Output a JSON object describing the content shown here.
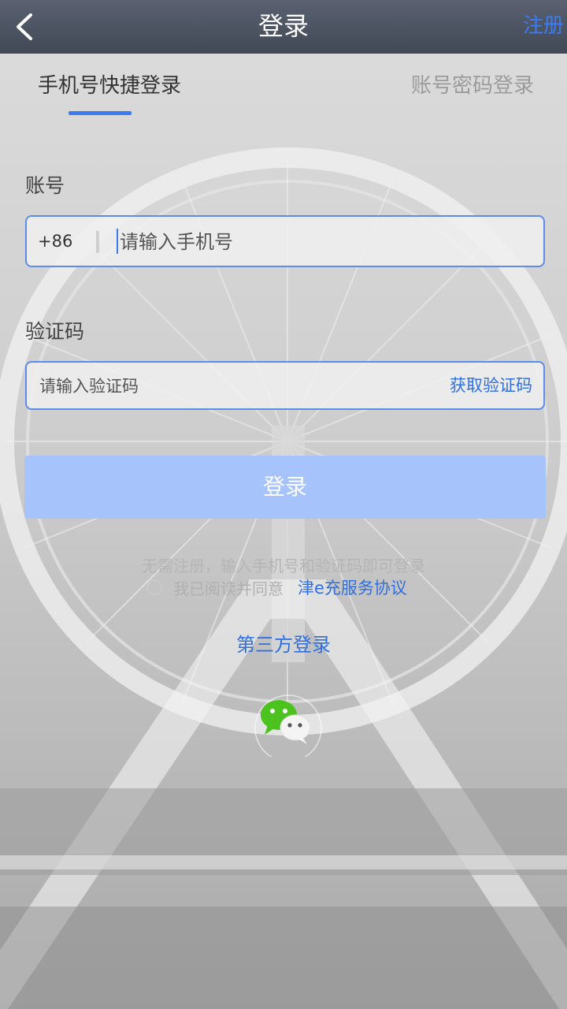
{
  "header": {
    "title": "登录",
    "register_label": "注册"
  },
  "tabs": {
    "quick_login": "手机号快捷登录",
    "password_login": "账号密码登录"
  },
  "account": {
    "label": "账号",
    "prefix": "+86",
    "placeholder": "请输入手机号",
    "value": ""
  },
  "code": {
    "label": "验证码",
    "placeholder": "请输入验证码",
    "value": "",
    "get_code_label": "获取验证码"
  },
  "login_button": "登录",
  "hint": "无需注册，输入手机号和验证码即可登录",
  "agreement": {
    "text": "我已阅读并同意",
    "link": "津e充服务协议",
    "checked": false
  },
  "third_party": {
    "title": "第三方登录",
    "providers": [
      "wechat-icon"
    ]
  },
  "colors": {
    "accent": "#3b7cf0",
    "button_disabled": "#a7c3fb",
    "topbar": "#4a505e",
    "wechat_green": "#4cc21f"
  }
}
